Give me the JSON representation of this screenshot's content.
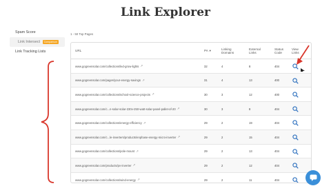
{
  "page": {
    "title": "Link Explorer"
  },
  "sidebar": {
    "items": [
      {
        "label": "Spam Score"
      },
      {
        "label": "Link Intersect",
        "badge": "Comparison"
      },
      {
        "label": "Link Tracking Lists"
      }
    ]
  },
  "results": {
    "count_label": "1 - 50",
    "unit_label": "Top Pages"
  },
  "table": {
    "headers": {
      "url": "URL",
      "pa": "PA",
      "linking_domains": "Linking Domains",
      "external_links": "External Links",
      "status_code": "Status Code",
      "view_links": "View Links"
    },
    "rows": [
      {
        "url": "www.gogreensolar.com/collections/led-grow-lights",
        "pa": "32",
        "ld": "4",
        "el": "8",
        "sc": "404"
      },
      {
        "url": "www.gogreensolar.com/pages/your-energy-savings",
        "pa": "31",
        "ld": "4",
        "el": "13",
        "sc": "400"
      },
      {
        "url": "www.gogreensolar.com/collections/school-science-projects",
        "pa": "30",
        "ld": "3",
        "el": "12",
        "sc": "400"
      },
      {
        "url": "www.gogreensolar.com/c...n-solar-solar-230v-250-watt-solar-panel-pallet-of-20",
        "pa": "30",
        "ld": "3",
        "el": "8",
        "sc": "404"
      },
      {
        "url": "www.gogreensolar.com/collections/energy-efficiency",
        "pa": "29",
        "ld": "2",
        "el": "19",
        "sc": "404"
      },
      {
        "url": "www.gogreensolar.com/c...le-inverters/products/enphase-energy-micro-inverter",
        "pa": "29",
        "ld": "2",
        "el": "15",
        "sc": "404"
      },
      {
        "url": "www.gogreensolar.com/collections/pole-mount",
        "pa": "29",
        "ld": "2",
        "el": "13",
        "sc": "404"
      },
      {
        "url": "www.gogreensolar.com/products/pv-inverter",
        "pa": "29",
        "ld": "2",
        "el": "12",
        "sc": "404"
      },
      {
        "url": "www.gogreensolar.com/collections/wind-energy",
        "pa": "29",
        "ld": "2",
        "el": "11",
        "sc": "404"
      }
    ]
  },
  "colors": {
    "accent": "#2a6ebd",
    "annotation": "#d9362b",
    "badge": "#f5a623",
    "chat": "#3a8fd9"
  },
  "icons": {
    "external": "external-link-icon",
    "search": "search-icon",
    "chat": "chat-icon"
  }
}
